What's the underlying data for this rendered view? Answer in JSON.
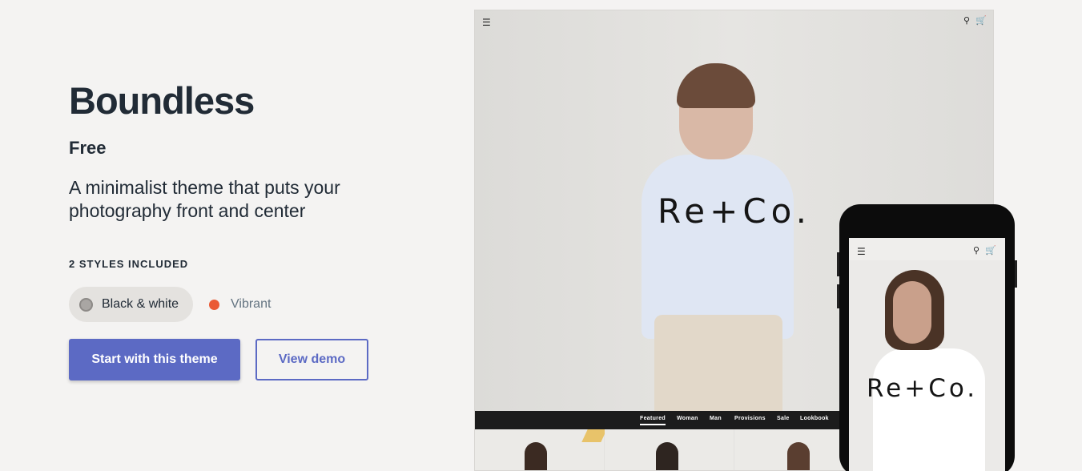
{
  "theme": {
    "title": "Boundless",
    "price": "Free",
    "description": "A minimalist theme that puts your photography front and center",
    "styles_heading": "2 STYLES INCLUDED",
    "styles": [
      {
        "label": "Black & white",
        "color": "#a9a6a3",
        "selected": true
      },
      {
        "label": "Vibrant",
        "color": "#ea5a34",
        "selected": false
      }
    ],
    "primary_button": "Start with this theme",
    "secondary_button": "View demo"
  },
  "preview": {
    "brand": "Re+Co.",
    "menu_icon": "hamburger-icon",
    "search_icon": "search-icon",
    "cart_icon": "cart-icon",
    "nav_items": [
      "Featured",
      "Woman",
      "Man",
      "Provisions",
      "Sale",
      "Lookbook"
    ],
    "active_nav": "Featured"
  },
  "colors": {
    "accent": "#5c6ac4",
    "background": "#f4f3f2",
    "text": "#212b36"
  }
}
